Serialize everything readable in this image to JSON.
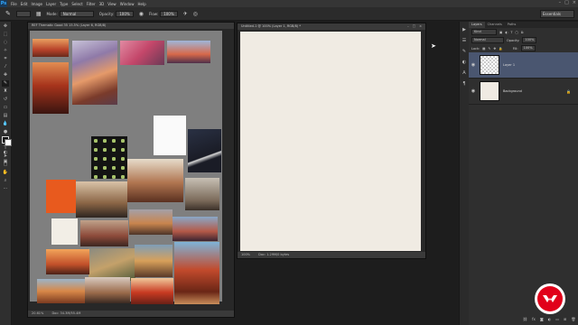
{
  "app": {
    "logo": "Ps"
  },
  "menu": [
    "File",
    "Edit",
    "Image",
    "Layer",
    "Type",
    "Select",
    "Filter",
    "3D",
    "View",
    "Window",
    "Help"
  ],
  "options_bar": {
    "mode_label": "Mode:",
    "mode_value": "Normal",
    "opacity_label": "Opacity:",
    "opacity_value": "100%",
    "flow_label": "Flow:",
    "flow_value": "100%",
    "workspace": "Essentials"
  },
  "ref_doc": {
    "tab_title": "REF Thematic Good 35 15.5% (Layer 6, RGB/8)",
    "status": "20.61%",
    "status_doc": "Doc: 34.3M/55.4M"
  },
  "main_doc": {
    "tab_title": "Untitled-1 @ 100% (Layer 1, RGB/8) *",
    "status": "100%",
    "status_doc": "Doc: 1.29M/0 bytes"
  },
  "layers_panel": {
    "tabs": [
      "Layers",
      "Channels",
      "Paths"
    ],
    "kind_label": "Kind",
    "blend_value": "Normal",
    "opacity_label": "Opacity:",
    "opacity_value": "100%",
    "lock_label": "Lock:",
    "fill_label": "Fill:",
    "fill_value": "100%",
    "layers": [
      {
        "name": "Layer 1"
      },
      {
        "name": "Background"
      }
    ]
  },
  "colors": {
    "menubar": "#353535",
    "canvas": "#f0ebe3",
    "ref_canvas": "#7f7f7f",
    "accent_red": "#e1001a"
  }
}
